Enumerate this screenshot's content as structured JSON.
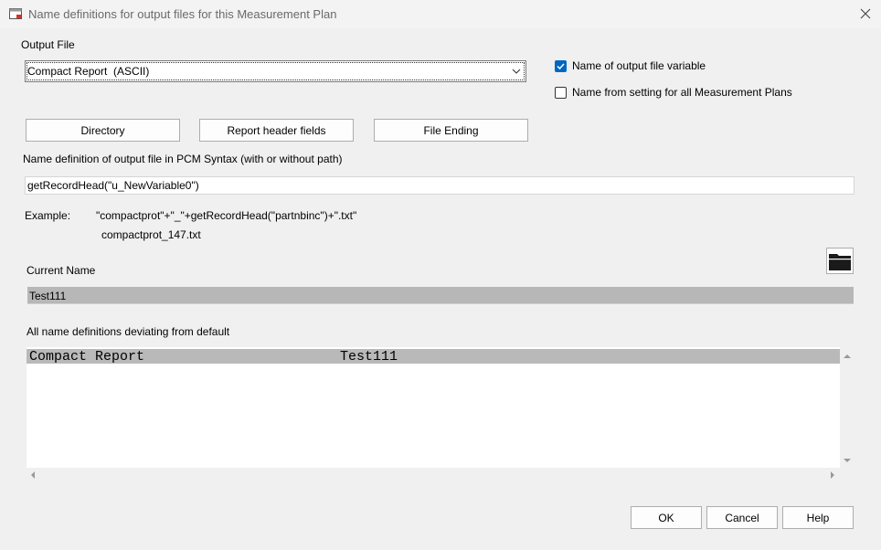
{
  "window": {
    "title": "Name definitions for output files for this Measurement Plan",
    "close_icon": "close-icon",
    "app_icon": "window-app-icon"
  },
  "output_file": {
    "label": "Output File",
    "selected": "Compact Report  (ASCII)"
  },
  "checkboxes": {
    "name_variable": {
      "label": "Name of output file variable",
      "checked": true
    },
    "name_from_setting": {
      "label": "Name from setting for all Measurement Plans",
      "checked": false
    }
  },
  "buttons": {
    "directory": "Directory",
    "report_header_fields": "Report header fields",
    "file_ending": "File Ending",
    "ok": "OK",
    "cancel": "Cancel",
    "help": "Help"
  },
  "name_definition": {
    "label": "Name definition of output file in PCM Syntax (with or without path)",
    "value": "getRecordHead(\"u_NewVariable0\")"
  },
  "example": {
    "label": "Example:",
    "syntax": "\"compactprot\"+\"_\"+getRecordHead(\"partnbinc\")+\".txt\"",
    "result": "compactprot_147.txt"
  },
  "current_name": {
    "label": "Current Name",
    "value": "Test111",
    "folder_icon": "folder-icon"
  },
  "deviating": {
    "label": "All name definitions deviating from default",
    "rows": [
      {
        "name": "Compact Report",
        "value": "Test111"
      }
    ]
  },
  "colors": {
    "accent": "#0067c0",
    "selection_gray": "#b9b9b9"
  }
}
